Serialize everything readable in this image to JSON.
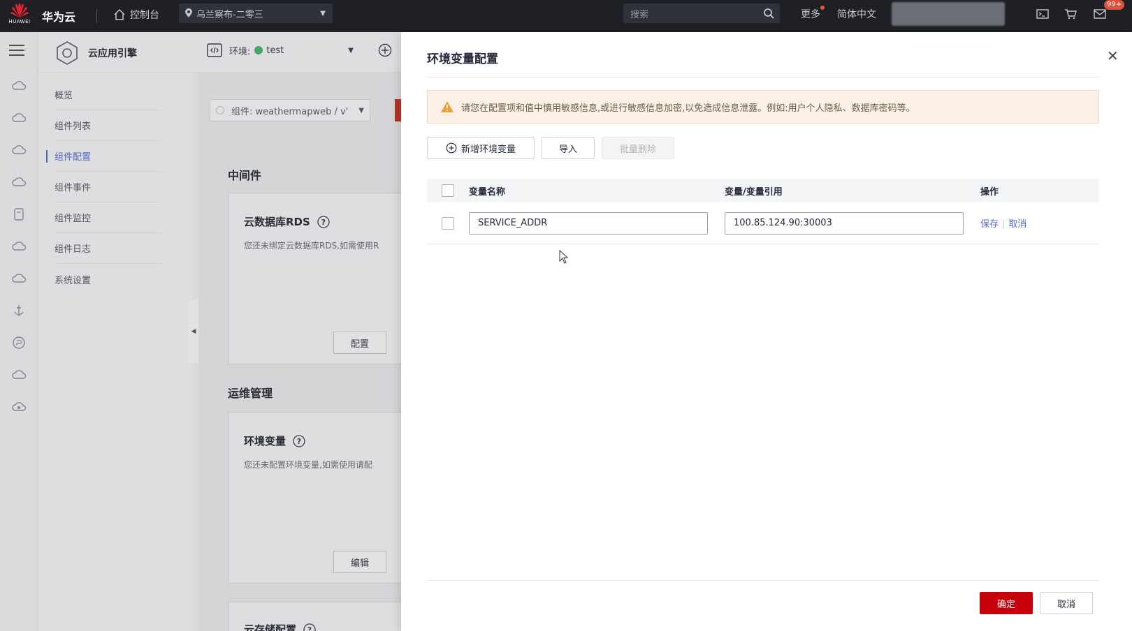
{
  "topbar": {
    "logo_text": "HUAWEI",
    "brand": "华为云",
    "console": "控制台",
    "region": "乌兰察布-二零三",
    "search_placeholder": "搜索",
    "more": "更多",
    "language": "简体中文",
    "badge": "99+"
  },
  "product": {
    "title": "云应用引擎",
    "env_label": "环境:",
    "env_value": "test"
  },
  "subnav": {
    "items": [
      {
        "label": "概览"
      },
      {
        "label": "组件列表"
      },
      {
        "label": "组件配置"
      },
      {
        "label": "组件事件"
      },
      {
        "label": "组件监控"
      },
      {
        "label": "组件日志"
      },
      {
        "label": "系统设置"
      }
    ],
    "active_index": 2
  },
  "main": {
    "component_selector": "组件: weathermapweb / v'",
    "middleware_title": "中间件",
    "rds_title": "云数据库RDS",
    "rds_desc": "您还未绑定云数据库RDS,如需使用R",
    "rds_button": "配置",
    "ops_title": "运维管理",
    "env_title": "环境变量",
    "env_desc": "您还未配置环境变量,如需使用请配",
    "env_button": "编辑",
    "storage_title": "云存储配置"
  },
  "drawer": {
    "title": "环境变量配置",
    "alert": "请您在配置项和值中慎用敏感信息,或进行敏感信息加密,以免造成信息泄露。例如:用户个人隐私、数据库密码等。",
    "add_button": "新增环境变量",
    "import_button": "导入",
    "batch_delete_button": "批量删除",
    "table": {
      "headers": [
        "变量名称",
        "变量/变量引用",
        "操作"
      ],
      "rows": [
        {
          "name": "SERVICE_ADDR",
          "value": "100.85.124.90:30003",
          "save": "保存",
          "cancel": "取消"
        }
      ]
    },
    "confirm_button": "确定",
    "cancel_button": "取消"
  },
  "colors": {
    "primary": "#c7000b",
    "link": "#526ecc",
    "topbar": "#1e2026",
    "env_status": "#4caf6e"
  }
}
